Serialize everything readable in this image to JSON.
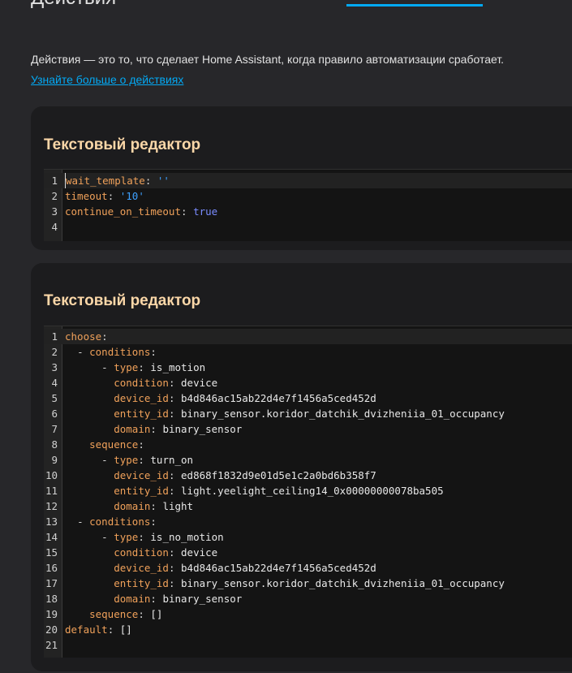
{
  "section": {
    "title": "Действия",
    "description": "Действия — это то, что сделает Home Assistant, когда правило автоматизации сработает.",
    "learn_more": "Узнайте больше о действиях"
  },
  "cards": [
    {
      "title": "Текстовый редактор",
      "lines": [
        {
          "n": "1",
          "key": "wait_template",
          "indent": "",
          "dash": "",
          "val": "''",
          "vtype": "s"
        },
        {
          "n": "2",
          "key": "timeout",
          "indent": "",
          "dash": "",
          "val": "'10'",
          "vtype": "s"
        },
        {
          "n": "3",
          "key": "continue_on_timeout",
          "indent": "",
          "dash": "",
          "val": "true",
          "vtype": "b"
        },
        {
          "n": "4",
          "key": "",
          "indent": "",
          "dash": "",
          "val": "",
          "vtype": "v"
        }
      ]
    },
    {
      "title": "Текстовый редактор",
      "lines": [
        {
          "n": "1",
          "indent": "",
          "dash": "",
          "key": "choose",
          "val": "",
          "vtype": "v"
        },
        {
          "n": "2",
          "indent": "  ",
          "dash": "- ",
          "key": "conditions",
          "val": "",
          "vtype": "v"
        },
        {
          "n": "3",
          "indent": "      ",
          "dash": "- ",
          "key": "type",
          "val": "is_motion",
          "vtype": "v"
        },
        {
          "n": "4",
          "indent": "        ",
          "dash": "",
          "key": "condition",
          "val": "device",
          "vtype": "v"
        },
        {
          "n": "5",
          "indent": "        ",
          "dash": "",
          "key": "device_id",
          "val": "b4d846ac15ab22d4e7f1456a5ced452d",
          "vtype": "v"
        },
        {
          "n": "6",
          "indent": "        ",
          "dash": "",
          "key": "entity_id",
          "val": "binary_sensor.koridor_datchik_dvizheniia_01_occupancy",
          "vtype": "v"
        },
        {
          "n": "7",
          "indent": "        ",
          "dash": "",
          "key": "domain",
          "val": "binary_sensor",
          "vtype": "v"
        },
        {
          "n": "8",
          "indent": "    ",
          "dash": "",
          "key": "sequence",
          "val": "",
          "vtype": "v"
        },
        {
          "n": "9",
          "indent": "      ",
          "dash": "- ",
          "key": "type",
          "val": "turn_on",
          "vtype": "v"
        },
        {
          "n": "10",
          "indent": "        ",
          "dash": "",
          "key": "device_id",
          "val": "ed868f1832d9e01d5e1c2a0bd6b358f7",
          "vtype": "v"
        },
        {
          "n": "11",
          "indent": "        ",
          "dash": "",
          "key": "entity_id",
          "val": "light.yeelight_ceiling14_0x00000000078ba505",
          "vtype": "v"
        },
        {
          "n": "12",
          "indent": "        ",
          "dash": "",
          "key": "domain",
          "val": "light",
          "vtype": "v"
        },
        {
          "n": "13",
          "indent": "  ",
          "dash": "- ",
          "key": "conditions",
          "val": "",
          "vtype": "v"
        },
        {
          "n": "14",
          "indent": "      ",
          "dash": "- ",
          "key": "type",
          "val": "is_no_motion",
          "vtype": "v"
        },
        {
          "n": "15",
          "indent": "        ",
          "dash": "",
          "key": "condition",
          "val": "device",
          "vtype": "v"
        },
        {
          "n": "16",
          "indent": "        ",
          "dash": "",
          "key": "device_id",
          "val": "b4d846ac15ab22d4e7f1456a5ced452d",
          "vtype": "v"
        },
        {
          "n": "17",
          "indent": "        ",
          "dash": "",
          "key": "entity_id",
          "val": "binary_sensor.koridor_datchik_dvizheniia_01_occupancy",
          "vtype": "v"
        },
        {
          "n": "18",
          "indent": "        ",
          "dash": "",
          "key": "domain",
          "val": "binary_sensor",
          "vtype": "v"
        },
        {
          "n": "19",
          "indent": "    ",
          "dash": "",
          "key": "sequence",
          "val": "[]",
          "vtype": "v"
        },
        {
          "n": "20",
          "indent": "",
          "dash": "",
          "key": "default",
          "val": "[]",
          "vtype": "v"
        },
        {
          "n": "21",
          "indent": "",
          "dash": "",
          "key": "",
          "val": "",
          "vtype": "v"
        }
      ]
    }
  ]
}
